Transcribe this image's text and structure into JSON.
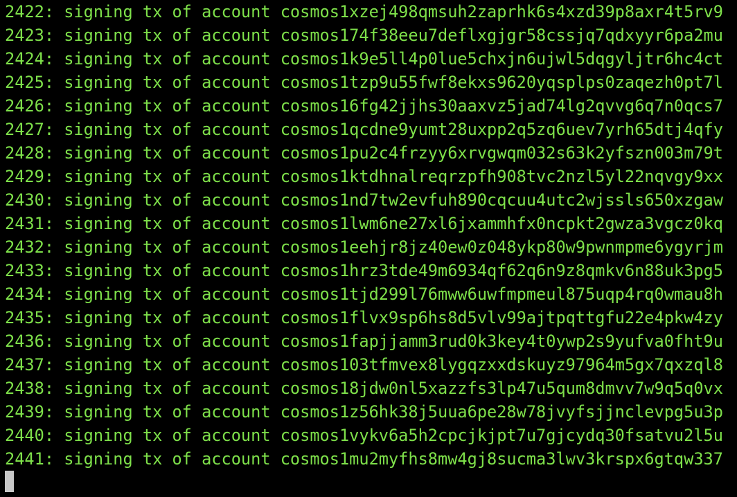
{
  "colors": {
    "background": "#000000",
    "text": "#7ee04a",
    "cursor": "#c8c8c8"
  },
  "terminal": {
    "lines": [
      "2422: signing tx of account cosmos1xzej498qmsuh2zaprhk6s4xzd39p8axr4t5rv9",
      "2423: signing tx of account cosmos174f38eeu7deflxgjgr58cssjq7qdxyyr6pa2mu",
      "2424: signing tx of account cosmos1k9e5ll4p0lue5chxjn6ujwl5dqgyljtr6hc4ct",
      "2425: signing tx of account cosmos1tzp9u55fwf8ekxs9620yqsplps0zaqezh0pt7l",
      "2426: signing tx of account cosmos16fg42jjhs30aaxvz5jad74lg2qvvg6q7n0qcs7",
      "2427: signing tx of account cosmos1qcdne9yumt28uxpp2q5zq6uev7yrh65dtj4qfy",
      "2428: signing tx of account cosmos1pu2c4frzyy6xrvgwqm032s63k2yfszn003m79t",
      "2429: signing tx of account cosmos1ktdhnalreqrzpfh908tvc2nzl5yl22nqvgy9xx",
      "2430: signing tx of account cosmos1nd7tw2evfuh890cqcuu4utc2wjssls650xzgaw",
      "2431: signing tx of account cosmos1lwm6ne27xl6jxammhfx0ncpkt2gwza3vgcz0kq",
      "2432: signing tx of account cosmos1eehjr8jz40ew0z048ykp80w9pwnmpme6ygyrjm",
      "2433: signing tx of account cosmos1hrz3tde49m6934qf62q6n9z8qmkv6n88uk3pg5",
      "2434: signing tx of account cosmos1tjd299l76mww6uwfmpmeul875uqp4rq0wmau8h",
      "2435: signing tx of account cosmos1flvx9sp6hs8d5vlv99ajtpqttgfu22e4pkw4zy",
      "2436: signing tx of account cosmos1fapjjamm3rud0k3key4t0ywp2s9yufva0fht9u",
      "2437: signing tx of account cosmos103tfmvex8lygqzxxdskuyz97964m5gx7qxzql8",
      "2438: signing tx of account cosmos18jdw0nl5xazzfs3lp47u5qum8dmvv7w9q5q0vx",
      "2439: signing tx of account cosmos1z56hk38j5uua6pe28w78jvyfsjjnclevpg5u3p",
      "2440: signing tx of account cosmos1vykv6a5h2cpcjkjpt7u7gjcydq30fsatvu2l5u",
      "2441: signing tx of account cosmos1mu2myfhs8mw4gj8sucma3lwv3krspx6gtqw337"
    ]
  }
}
